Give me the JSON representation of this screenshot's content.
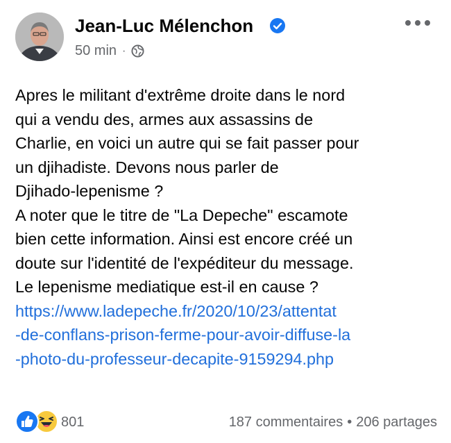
{
  "post": {
    "author": "Jean-Luc Mélenchon",
    "time": "50 min",
    "time_separator": "·",
    "lines": [
      "Apres le militant d'extrême droite dans le nord",
      "qui a vendu des, armes aux assassins de",
      "Charlie, en voici un autre qui se fait passer pour",
      "un djihadiste. Devons nous parler de",
      "Djihado-lepenisme ?",
      "A noter que le titre de \"La Depeche\" escamote",
      "bien cette information. Ainsi est encore créé un",
      "doute sur l'identité de l'expéditeur du message.",
      "Le lepenisme mediatique est-il en cause ?"
    ],
    "link_lines": [
      "https://www.ladepeche.fr/2020/10/23/attentat",
      "-de-conflans-prison-ferme-pour-avoir-diffuse-la",
      "-photo-du-professeur-decapite-9159294.php"
    ]
  },
  "footer": {
    "reaction_count": "801",
    "comments": "187 commentaires",
    "separator": "•",
    "shares": "206 partages"
  },
  "icons": {
    "verified": "verified-badge-icon",
    "audience": "globe-icon",
    "more": "more-options-icon",
    "reaction_like": "like-reaction-icon",
    "reaction_haha": "haha-reaction-icon"
  },
  "colors": {
    "text": "#050505",
    "secondary": "#65676b",
    "link": "#216fdb",
    "verified": "#1877f2"
  }
}
